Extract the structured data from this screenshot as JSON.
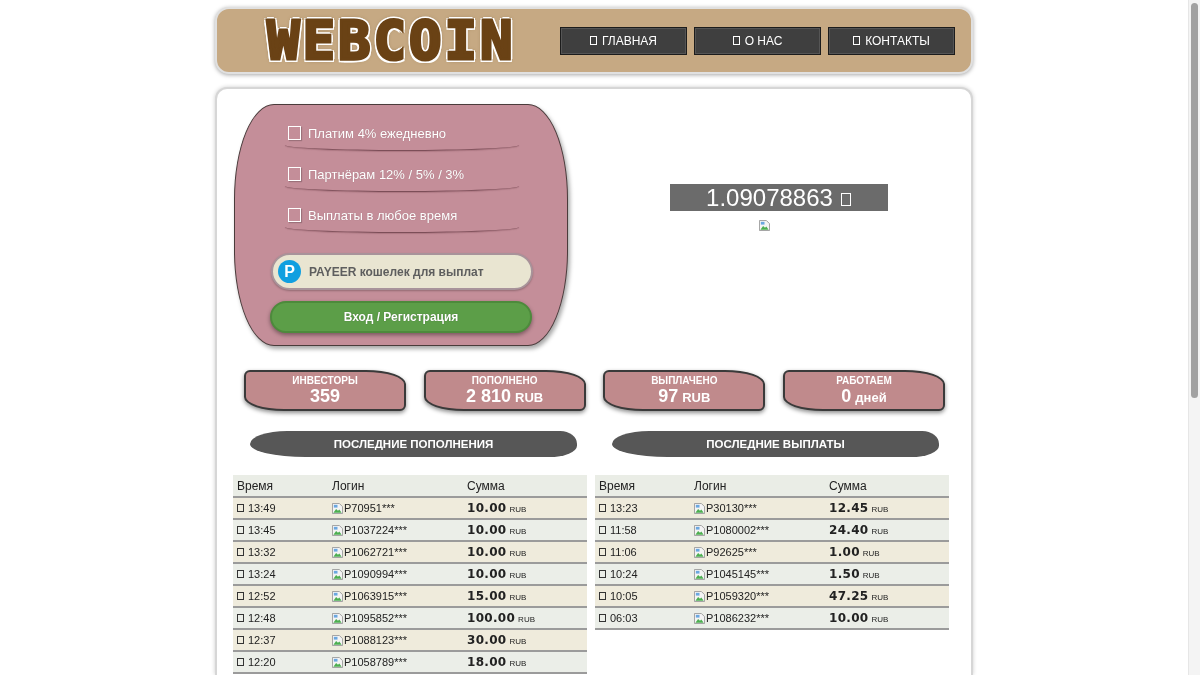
{
  "header": {
    "logo": "WEBCOIN",
    "nav": [
      {
        "label": "ГЛАВНАЯ"
      },
      {
        "label": "О НАС"
      },
      {
        "label": "КОНТАКТЫ"
      }
    ]
  },
  "promo": {
    "features": [
      "Платим 4% ежедневно",
      "Партнёрам 12% / 5% / 3%",
      "Выплаты в любое время"
    ],
    "wallet_field": {
      "logo": "P",
      "placeholder": "PAYEER кошелек для выплат"
    },
    "login_button": "Вход / Регистрация"
  },
  "counter": {
    "value": "1.09078863"
  },
  "stats": [
    {
      "label": "ИНВЕСТОРЫ",
      "value": "359"
    },
    {
      "label": "ПОПОЛНЕНО",
      "value": "2 810",
      "unit": "RUB"
    },
    {
      "label": "ВЫПЛАЧЕНО",
      "value": "97",
      "unit": "RUB"
    },
    {
      "label": "РАБОТАЕМ",
      "value": "0",
      "unit": "дней"
    }
  ],
  "tables": [
    {
      "title": "ПОСЛЕДНИЕ ПОПОЛНЕНИЯ",
      "columns": [
        "Время",
        "Логин",
        "Сумма"
      ],
      "rows": [
        {
          "time": "13:49",
          "login": "P70951***",
          "amount": "10.00",
          "currency": "RUB"
        },
        {
          "time": "13:45",
          "login": "P1037224***",
          "amount": "10.00",
          "currency": "RUB"
        },
        {
          "time": "13:32",
          "login": "P1062721***",
          "amount": "10.00",
          "currency": "RUB"
        },
        {
          "time": "13:24",
          "login": "P1090994***",
          "amount": "10.00",
          "currency": "RUB"
        },
        {
          "time": "12:52",
          "login": "P1063915***",
          "amount": "15.00",
          "currency": "RUB"
        },
        {
          "time": "12:48",
          "login": "P1095852***",
          "amount": "100.00",
          "currency": "RUB"
        },
        {
          "time": "12:37",
          "login": "P1088123***",
          "amount": "30.00",
          "currency": "RUB"
        },
        {
          "time": "12:20",
          "login": "P1058789***",
          "amount": "18.00",
          "currency": "RUB"
        }
      ]
    },
    {
      "title": "ПОСЛЕДНИЕ ВЫПЛАТЫ",
      "columns": [
        "Время",
        "Логин",
        "Сумма"
      ],
      "rows": [
        {
          "time": "13:23",
          "login": "P30130***",
          "amount": "12.45",
          "currency": "RUB"
        },
        {
          "time": "11:58",
          "login": "P1080002***",
          "amount": "24.40",
          "currency": "RUB"
        },
        {
          "time": "11:06",
          "login": "P92625***",
          "amount": "1.00",
          "currency": "RUB"
        },
        {
          "time": "10:24",
          "login": "P1045145***",
          "amount": "1.50",
          "currency": "RUB"
        },
        {
          "time": "10:05",
          "login": "P1059320***",
          "amount": "47.25",
          "currency": "RUB"
        },
        {
          "time": "06:03",
          "login": "P1086232***",
          "amount": "10.00",
          "currency": "RUB"
        }
      ]
    }
  ]
}
